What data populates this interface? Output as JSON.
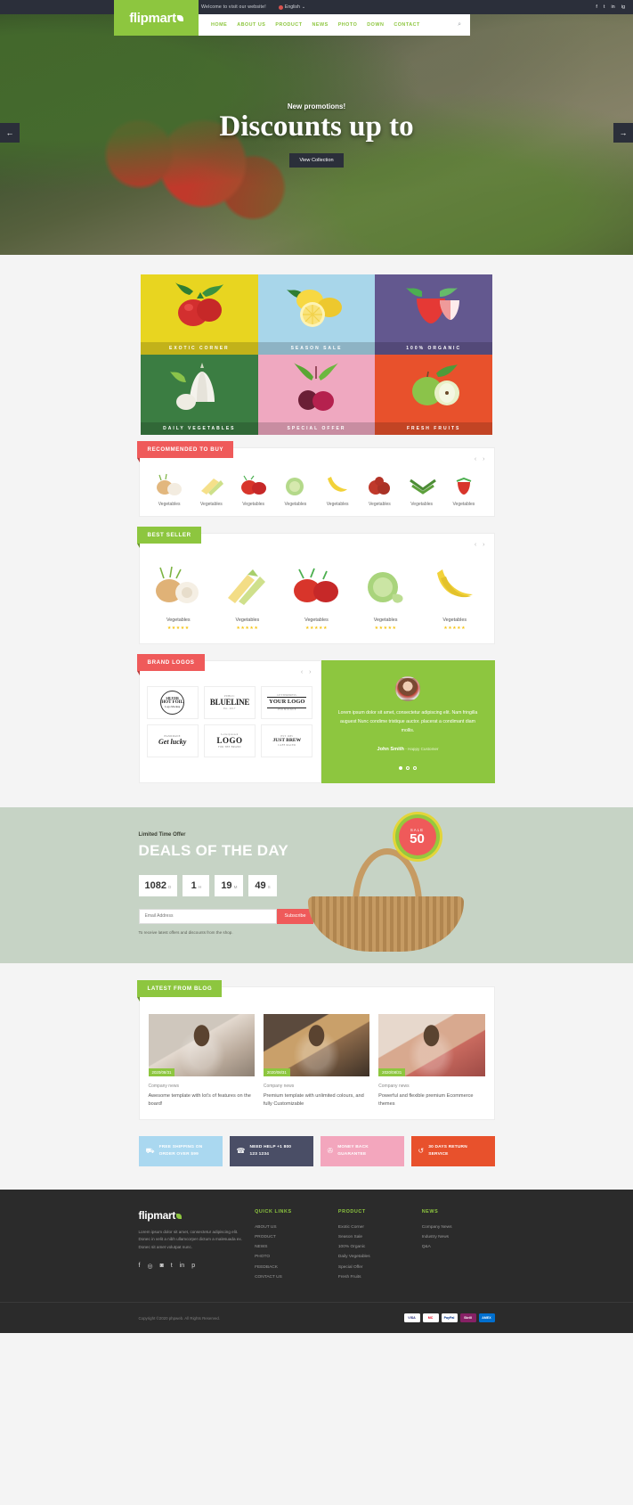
{
  "topbar": {
    "welcome": "Welcome to visit our website!",
    "language": "English",
    "language_caret": "⌄",
    "socials": [
      "f",
      "t",
      "in",
      "ig"
    ]
  },
  "brand": {
    "name": "flipmart"
  },
  "nav": {
    "items": [
      "HOME",
      "ABOUT US",
      "PRODUCT",
      "NEWS",
      "PHOTO",
      "DOWN",
      "CONTACT"
    ],
    "search_icon": "⌕"
  },
  "hero": {
    "kicker": "New promotions!",
    "title": "Discounts up to",
    "button": "View Collection",
    "prev": "←",
    "next": "→"
  },
  "categories": [
    {
      "label": "EXOTIC CORNER"
    },
    {
      "label": "SEASON SALE"
    },
    {
      "label": "100% ORGANIC"
    },
    {
      "label": "DAILY VEGETABLES"
    },
    {
      "label": "SPECIAL OFFER"
    },
    {
      "label": "FRESH FRUITS"
    }
  ],
  "recommended": {
    "title": "RECOMMENDED TO BUY",
    "prev": "‹",
    "next": "›",
    "items": [
      {
        "name": "Vegetables"
      },
      {
        "name": "Vegetables"
      },
      {
        "name": "Vegetables"
      },
      {
        "name": "Vegetables"
      },
      {
        "name": "Vegetables"
      },
      {
        "name": "Vegetables"
      },
      {
        "name": "Vegetables"
      },
      {
        "name": "Vegetables"
      }
    ]
  },
  "bestseller": {
    "title": "BEST SELLER",
    "prev": "‹",
    "next": "›",
    "items": [
      {
        "name": "Vegetables",
        "stars": "★★★★★"
      },
      {
        "name": "Vegetables",
        "stars": "★★★★★"
      },
      {
        "name": "Vegetables",
        "stars": "★★★★★"
      },
      {
        "name": "Vegetables",
        "stars": "★★★★★"
      },
      {
        "name": "Vegetables",
        "stars": "★★★★★"
      }
    ]
  },
  "brands": {
    "title": "BRAND LOGOS",
    "prev": "‹",
    "next": "›",
    "items": [
      {
        "main": "HOT FOIL",
        "top": "SILVER",
        "bottom": "Logo Mockup"
      },
      {
        "main": "BLUELINE",
        "top": "PUBLIC",
        "bottom": "Est. 2017"
      },
      {
        "main": "YOUR LOGO",
        "top": "LETTERPRESS",
        "bottom": "PSD MOCKUP"
      },
      {
        "main": "Get lucky",
        "top": "HANDMADE",
        "bottom": ""
      },
      {
        "main": "LOGO",
        "top": "Letterpressed",
        "bottom": "FOR THE BRAND"
      },
      {
        "main": "JUST BREW",
        "top": "EST 1985",
        "bottom": "CAFE RACER"
      }
    ]
  },
  "testimonial": {
    "quote": "Lorem ipsum dolor sit amet, consectetur adipiscing elit. Nam fringilla auguest Nunc condime tristique auctor. placerat a condimant diam mollis.",
    "name": "John Smith",
    "role": " - Happy Customer",
    "dots": [
      true,
      false,
      false
    ]
  },
  "deals": {
    "kicker": "Limited Time Offer",
    "title": "DEALS OF THE DAY",
    "counters": [
      {
        "value": "1082",
        "unit": "D"
      },
      {
        "value": "1",
        "unit": "H"
      },
      {
        "value": "19",
        "unit": "M"
      },
      {
        "value": "49",
        "unit": "S"
      }
    ],
    "email_placeholder": "Email Address",
    "subscribe_label": "Subscribe",
    "note": "To receive latest offers and discounts from the shop.",
    "badge_top": "SALE",
    "badge_value": "50"
  },
  "blog": {
    "title": "LATEST FROM BLOG",
    "posts": [
      {
        "date": "2020/08/31",
        "category": "Company news",
        "title": "Awesome template with lot's of features on the board!"
      },
      {
        "date": "2020/08/31",
        "category": "Company news",
        "title": "Premium template with unlimited colours, and fully Customizable"
      },
      {
        "date": "2020/08/31",
        "category": "Company news",
        "title": "Powerful and flexible premium Ecommerce themes"
      }
    ]
  },
  "services": [
    {
      "icon": "⛟",
      "line1": "FREE SHIPPING ON",
      "line2": "ORDER OVER $99"
    },
    {
      "icon": "☎",
      "line1": "NEED HELP +1 800",
      "line2": "123 1234"
    },
    {
      "icon": "✇",
      "line1": "MONEY BACK",
      "line2": "GUARANTEE"
    },
    {
      "icon": "↺",
      "line1": "30 DAYS RETURN",
      "line2": "SERVICE"
    }
  ],
  "footer": {
    "brand": "flipmart",
    "about": "Lorem ipsum dolor sit amet, consectetur adipiscing elit. Donec in velit a nibh ullamcorper dictum a malesuada ex. Donec sit amet volutpat nunc.",
    "socials": [
      "f",
      "◎",
      "◙",
      "t",
      "in",
      "p"
    ],
    "columns": [
      {
        "head": "QUICK LINKS",
        "links": [
          "ABOUT US",
          "PRODUCT",
          "NEWS",
          "PHOTO",
          "FEEDBACK",
          "CONTACT US"
        ]
      },
      {
        "head": "PRODUCT",
        "links": [
          "Exotic Corner",
          "Season Sale",
          "100% Organic",
          "Daily Vegetables",
          "Special Offer",
          "Fresh Fruits"
        ]
      },
      {
        "head": "NEWS",
        "links": [
          "Company News",
          "Industry News",
          "Q&A"
        ]
      }
    ],
    "copyright": "Copyright ©2020 phpweb. All Rights Reserved.",
    "payments": [
      "VISA",
      "MC",
      "PayPal",
      "Skrill",
      "AMEX"
    ]
  }
}
